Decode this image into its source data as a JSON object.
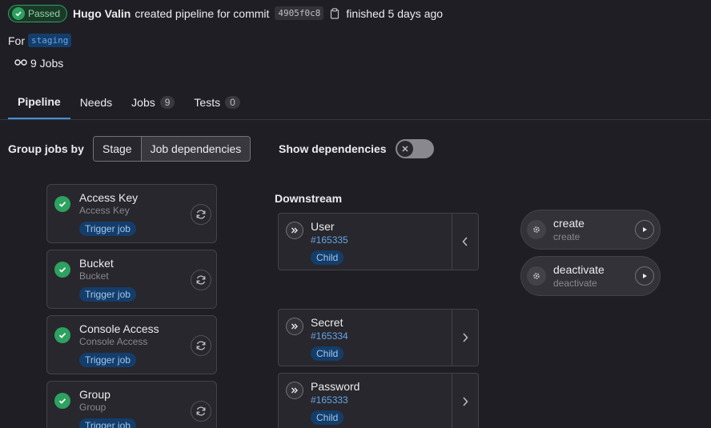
{
  "header": {
    "status_label": "Passed",
    "author": "Hugo Valin",
    "action_text": "created pipeline for commit",
    "commit_sha": "4905f0c8",
    "finished_text": "finished 5 days ago",
    "for_label": "For",
    "ref": "staging",
    "jobs_count_text": "9 Jobs"
  },
  "tabs": [
    {
      "label": "Pipeline",
      "count": null,
      "active": true
    },
    {
      "label": "Needs",
      "count": null
    },
    {
      "label": "Jobs",
      "count": "9"
    },
    {
      "label": "Tests",
      "count": "0"
    }
  ],
  "controls": {
    "group_label": "Group jobs by",
    "options": [
      "Stage",
      "Job dependencies"
    ],
    "selected": "Job dependencies",
    "show_dependencies_label": "Show dependencies",
    "show_dependencies": false
  },
  "jobs": [
    {
      "name": "Access Key",
      "sub": "Access Key",
      "badge": "Trigger job"
    },
    {
      "name": "Bucket",
      "sub": "Bucket",
      "badge": "Trigger job"
    },
    {
      "name": "Console Access",
      "sub": "Console Access",
      "badge": "Trigger job"
    },
    {
      "name": "Group",
      "sub": "Group",
      "badge": "Trigger job"
    }
  ],
  "downstream": {
    "label": "Downstream",
    "pipelines": [
      {
        "name": "User",
        "id": "#165335",
        "badge": "Child",
        "expanded": true
      },
      {
        "name": "Secret",
        "id": "#165334",
        "badge": "Child",
        "expanded": false
      },
      {
        "name": "Password",
        "id": "#165333",
        "badge": "Child",
        "expanded": false
      }
    ]
  },
  "child_jobs": [
    {
      "name": "create",
      "sub": "create"
    },
    {
      "name": "deactivate",
      "sub": "deactivate"
    }
  ],
  "colors": {
    "background": "#1f1e24",
    "success": "#2da160",
    "accent": "#428fdc"
  }
}
